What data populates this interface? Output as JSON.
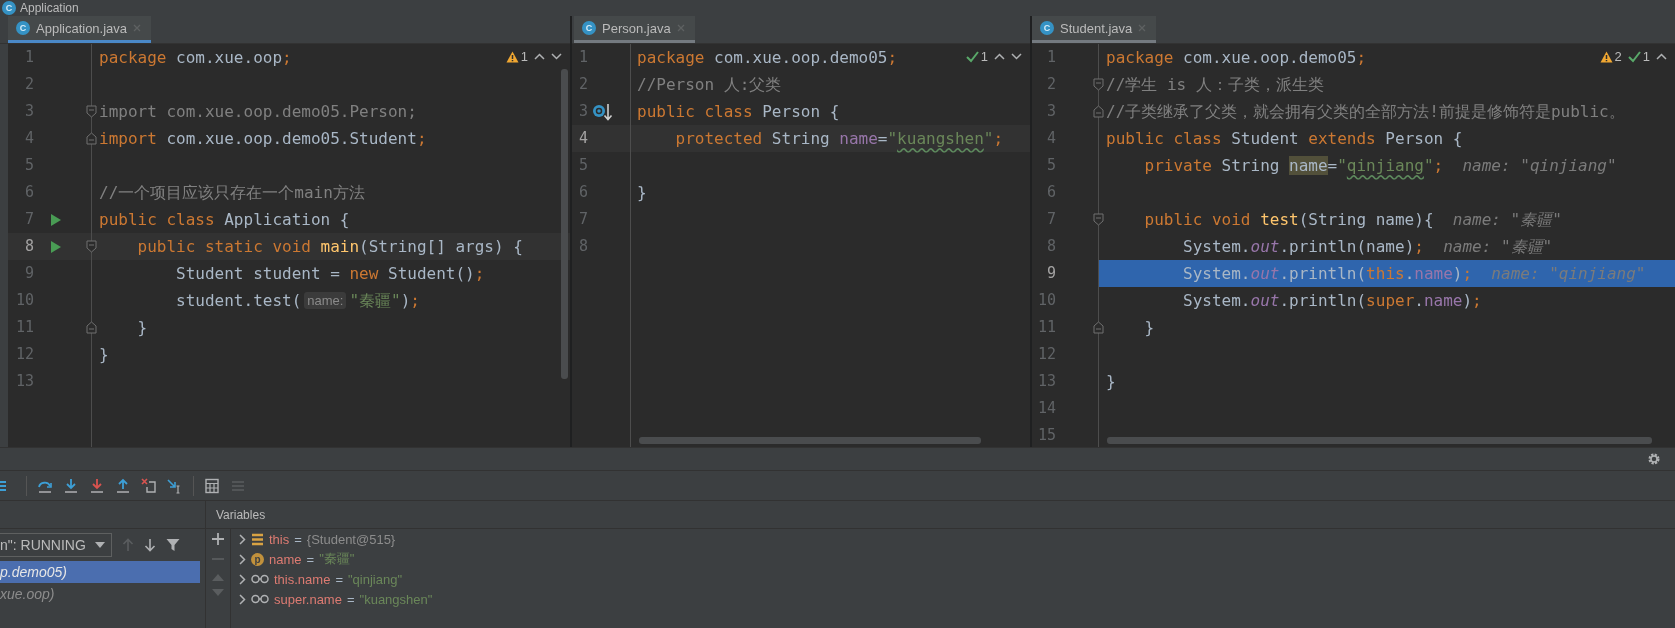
{
  "window": {
    "title": "Application",
    "icon_text": "C"
  },
  "editors": [
    {
      "active": true,
      "tab": {
        "label": "Application.java",
        "icon_text": "C",
        "selected": true
      },
      "badges": [
        {
          "kind": "warning",
          "count": "1"
        }
      ],
      "nav": [
        {
          "kind": "up"
        },
        {
          "kind": "down"
        }
      ],
      "scrollbar": {
        "kind": "vertical"
      },
      "side_strip": {
        "kind": "tool_window"
      },
      "lines": [
        {
          "number": "1",
          "code": [
            {
              "text": "package",
              "kind": "kw"
            },
            {
              "text": " com.xue.oop",
              "kind": "plain"
            },
            {
              "text": ";",
              "kind": "kw"
            }
          ]
        },
        {
          "number": "2"
        },
        {
          "number": "3",
          "fold": {
            "kind": "start"
          },
          "code": [
            {
              "text": "import com.xue.oop.demo05.Person;",
              "kind": "unused"
            }
          ]
        },
        {
          "number": "4",
          "fold": {
            "kind": "end"
          },
          "code": [
            {
              "text": "import",
              "kind": "kw"
            },
            {
              "text": " com.xue.oop.demo05.Student",
              "kind": "plain"
            },
            {
              "text": ";",
              "kind": "kw"
            }
          ]
        },
        {
          "number": "5"
        },
        {
          "number": "6",
          "code": [
            {
              "text": "//一个项目应该只存在一个main方法",
              "kind": "comment"
            }
          ]
        },
        {
          "number": "7",
          "gutter": {
            "kind": "run"
          },
          "code": [
            {
              "text": "public class",
              "kind": "kw"
            },
            {
              "text": " Application {",
              "kind": "plain"
            }
          ]
        },
        {
          "number": "8",
          "gutter": {
            "kind": "run"
          },
          "fold": {
            "kind": "start"
          },
          "highlight": {
            "kind": "current"
          },
          "code": [
            {
              "text": "    public static void ",
              "kind": "kw"
            },
            {
              "text": "main",
              "kind": "method"
            },
            {
              "text": "(String[] args) {",
              "kind": "plain"
            }
          ]
        },
        {
          "number": "9",
          "code": [
            {
              "text": "        Student student = ",
              "kind": "plain"
            },
            {
              "text": "new",
              "kind": "kw"
            },
            {
              "text": " Student()",
              "kind": "plain"
            },
            {
              "text": ";",
              "kind": "kw"
            }
          ]
        },
        {
          "number": "10",
          "code": [
            {
              "text": "        student.test(",
              "kind": "plain"
            },
            {
              "text": "name:",
              "kind": "hint"
            },
            {
              "text": "\"秦疆\"",
              "kind": "str"
            },
            {
              "text": ")",
              "kind": "plain"
            },
            {
              "text": ";",
              "kind": "kw"
            }
          ]
        },
        {
          "number": "11",
          "fold": {
            "kind": "end"
          },
          "code": [
            {
              "text": "    }",
              "kind": "plain"
            }
          ]
        },
        {
          "number": "12",
          "code": [
            {
              "text": "}",
              "kind": "plain"
            }
          ]
        },
        {
          "number": "13"
        }
      ]
    },
    {
      "active": false,
      "tab": {
        "label": "Person.java",
        "icon_text": "C",
        "selected": true
      },
      "badges": [
        {
          "kind": "typo",
          "count": "1"
        }
      ],
      "nav": [
        {
          "kind": "up"
        },
        {
          "kind": "down"
        }
      ],
      "scrollbar": {
        "kind": "horizontal"
      },
      "lines": [
        {
          "number": "1",
          "code": [
            {
              "text": "package",
              "kind": "kw"
            },
            {
              "text": " com.xue.oop.demo05",
              "kind": "plain"
            },
            {
              "text": ";",
              "kind": "kw"
            }
          ]
        },
        {
          "number": "2",
          "code": [
            {
              "text": "//Person 人:父类",
              "kind": "comment"
            }
          ]
        },
        {
          "number": "3",
          "gutter": {
            "kind": "override"
          },
          "code": [
            {
              "text": "public class",
              "kind": "kw"
            },
            {
              "text": " Person {",
              "kind": "plain"
            }
          ]
        },
        {
          "number": "4",
          "highlight": {
            "kind": "current"
          },
          "code": [
            {
              "text": "    protected",
              "kind": "kw"
            },
            {
              "text": " String ",
              "kind": "plain"
            },
            {
              "text": "name",
              "kind": "field"
            },
            {
              "text": "=",
              "kind": "plain"
            },
            {
              "text": "\"",
              "kind": "str"
            },
            {
              "text": "kuangshen",
              "kind": "str_typo"
            },
            {
              "text": "\"",
              "kind": "str"
            },
            {
              "text": ";",
              "kind": "kw"
            }
          ]
        },
        {
          "number": "5"
        },
        {
          "number": "6",
          "code": [
            {
              "text": "}",
              "kind": "plain"
            }
          ]
        },
        {
          "number": "7"
        },
        {
          "number": "8"
        }
      ]
    },
    {
      "active": false,
      "tab": {
        "label": "Student.java",
        "icon_text": "C",
        "selected": true
      },
      "badges": [
        {
          "kind": "warning",
          "count": "2"
        },
        {
          "kind": "typo",
          "count": "1"
        }
      ],
      "nav": [
        {
          "kind": "up"
        }
      ],
      "scrollbar": {
        "kind": "horizontal"
      },
      "lines": [
        {
          "number": "1",
          "code": [
            {
              "text": "package",
              "kind": "kw"
            },
            {
              "text": " com.xue.oop.demo05",
              "kind": "plain"
            },
            {
              "text": ";",
              "kind": "kw"
            }
          ]
        },
        {
          "number": "2",
          "fold": {
            "kind": "start"
          },
          "code": [
            {
              "text": "//学生 is 人：子类，派生类",
              "kind": "comment"
            }
          ]
        },
        {
          "number": "3",
          "fold": {
            "kind": "end"
          },
          "code": [
            {
              "text": "//子类继承了父类，就会拥有父类的全部方法!前提是修饰符是public。",
              "kind": "comment"
            }
          ]
        },
        {
          "number": "4",
          "code": [
            {
              "text": "public class",
              "kind": "kw"
            },
            {
              "text": " Student ",
              "kind": "plain"
            },
            {
              "text": "extends",
              "kind": "kw"
            },
            {
              "text": " Person {",
              "kind": "plain"
            }
          ]
        },
        {
          "number": "5",
          "code": [
            {
              "text": "    private",
              "kind": "kw"
            },
            {
              "text": " String ",
              "kind": "plain"
            },
            {
              "text": "name",
              "kind": "marked"
            },
            {
              "text": "=",
              "kind": "plain"
            },
            {
              "text": "\"",
              "kind": "str"
            },
            {
              "text": "qinjiang",
              "kind": "str_typo"
            },
            {
              "text": "\"",
              "kind": "str"
            },
            {
              "text": ";",
              "kind": "kw"
            },
            {
              "text": "name: \"qinjiang\"",
              "kind": "inline_value"
            }
          ]
        },
        {
          "number": "6"
        },
        {
          "number": "7",
          "fold": {
            "kind": "start"
          },
          "code": [
            {
              "text": "    public void ",
              "kind": "kw"
            },
            {
              "text": "test",
              "kind": "method"
            },
            {
              "text": "(String name){",
              "kind": "plain"
            },
            {
              "text": "name: \"秦疆\"",
              "kind": "inline_value"
            }
          ]
        },
        {
          "number": "8",
          "code": [
            {
              "text": "        System.",
              "kind": "plain"
            },
            {
              "text": "out",
              "kind": "static"
            },
            {
              "text": ".println(name)",
              "kind": "plain"
            },
            {
              "text": ";",
              "kind": "kw"
            },
            {
              "text": "name: \"秦疆\"",
              "kind": "inline_value"
            }
          ]
        },
        {
          "number": "9",
          "highlight": {
            "kind": "execution"
          },
          "code": [
            {
              "text": "        System.",
              "kind": "plain"
            },
            {
              "text": "out",
              "kind": "static"
            },
            {
              "text": ".println(",
              "kind": "plain"
            },
            {
              "text": "this",
              "kind": "kw"
            },
            {
              "text": ".",
              "kind": "plain"
            },
            {
              "text": "name",
              "kind": "field"
            },
            {
              "text": ")",
              "kind": "plain"
            },
            {
              "text": ";",
              "kind": "kw"
            },
            {
              "text": "name: \"qinjiang\"",
              "kind": "inline_value"
            }
          ]
        },
        {
          "number": "10",
          "code": [
            {
              "text": "        System.",
              "kind": "plain"
            },
            {
              "text": "out",
              "kind": "static"
            },
            {
              "text": ".println(",
              "kind": "plain"
            },
            {
              "text": "super",
              "kind": "kw"
            },
            {
              "text": ".",
              "kind": "plain"
            },
            {
              "text": "name",
              "kind": "field"
            },
            {
              "text": ")",
              "kind": "plain"
            },
            {
              "text": ";",
              "kind": "kw"
            }
          ]
        },
        {
          "number": "11",
          "fold": {
            "kind": "end"
          },
          "code": [
            {
              "text": "    }",
              "kind": "plain"
            }
          ]
        },
        {
          "number": "12"
        },
        {
          "number": "13",
          "code": [
            {
              "text": "}",
              "kind": "plain"
            }
          ]
        },
        {
          "number": "14"
        },
        {
          "number": "15"
        }
      ]
    }
  ],
  "frames": {
    "dropdown": "n\": RUNNING",
    "items": [
      {
        "label": "p.demo05)",
        "selected": true
      },
      {
        "label": "xue.oop)",
        "selected": false
      }
    ]
  },
  "variables": {
    "title": "Variables",
    "items": [
      {
        "kind": "object",
        "name": "this",
        "operator": "=",
        "value": {
          "text": "{Student@515}",
          "kind": "object"
        }
      },
      {
        "kind": "parameter",
        "icon_text": "p",
        "name": "name",
        "operator": "=",
        "value": {
          "text": "\"秦疆\"",
          "kind": "string"
        }
      },
      {
        "kind": "watch",
        "name": "this.name",
        "operator": "=",
        "value": {
          "text": "\"qinjiang\"",
          "kind": "string"
        }
      },
      {
        "kind": "watch",
        "name": "super.name",
        "operator": "=",
        "value": {
          "text": "\"kuangshen\"",
          "kind": "string"
        }
      }
    ]
  }
}
